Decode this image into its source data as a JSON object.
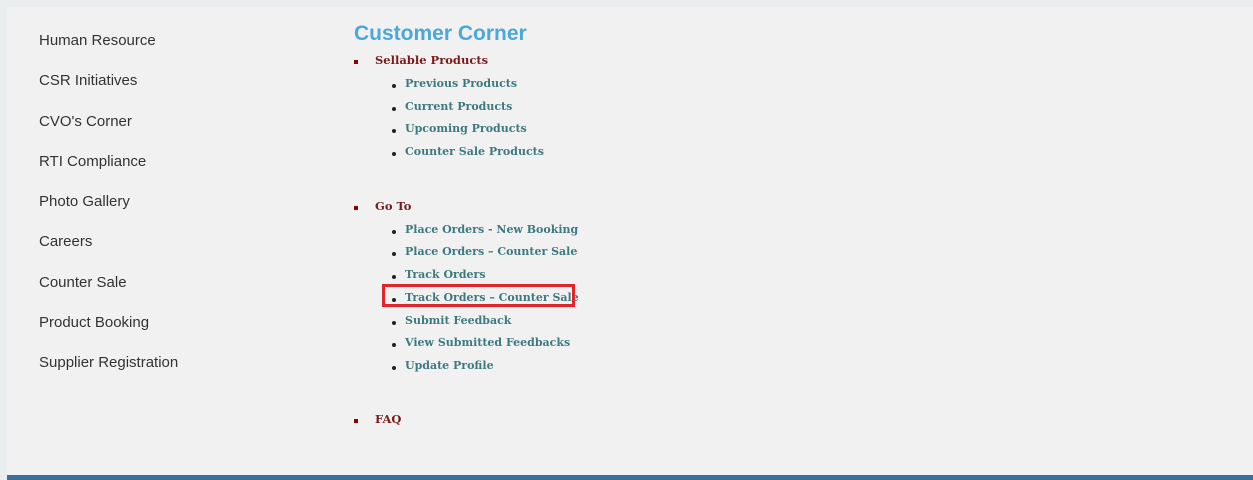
{
  "left_nav": {
    "items": [
      {
        "label": "Human Resource"
      },
      {
        "label": "CSR Initiatives"
      },
      {
        "label": "CVO's Corner"
      },
      {
        "label": "RTI Compliance"
      },
      {
        "label": "Photo Gallery"
      },
      {
        "label": "Careers"
      },
      {
        "label": "Counter Sale"
      },
      {
        "label": "Product Booking"
      },
      {
        "label": "Supplier Registration"
      }
    ]
  },
  "main": {
    "title": "Customer Corner",
    "sections": [
      {
        "heading": "Sellable Products",
        "links": [
          {
            "label": "Previous Products"
          },
          {
            "label": "Current Products"
          },
          {
            "label": "Upcoming Products"
          },
          {
            "label": "Counter Sale Products"
          }
        ]
      },
      {
        "heading": "Go To",
        "links": [
          {
            "label": "Place Orders - New Booking"
          },
          {
            "label": "Place Orders – Counter Sale"
          },
          {
            "label": "Track Orders"
          },
          {
            "label": "Track Orders – Counter Sale"
          },
          {
            "label": "Submit Feedback"
          },
          {
            "label": "View Submitted Feedbacks"
          },
          {
            "label": "Update Profile"
          }
        ]
      },
      {
        "heading": "FAQ",
        "links": []
      }
    ]
  },
  "colors": {
    "title": "#4ba8d7",
    "section_heading": "#7a1a1a",
    "link": "#3d7a80",
    "highlight_border": "#e0262b",
    "footer": "#3c6f9e"
  }
}
